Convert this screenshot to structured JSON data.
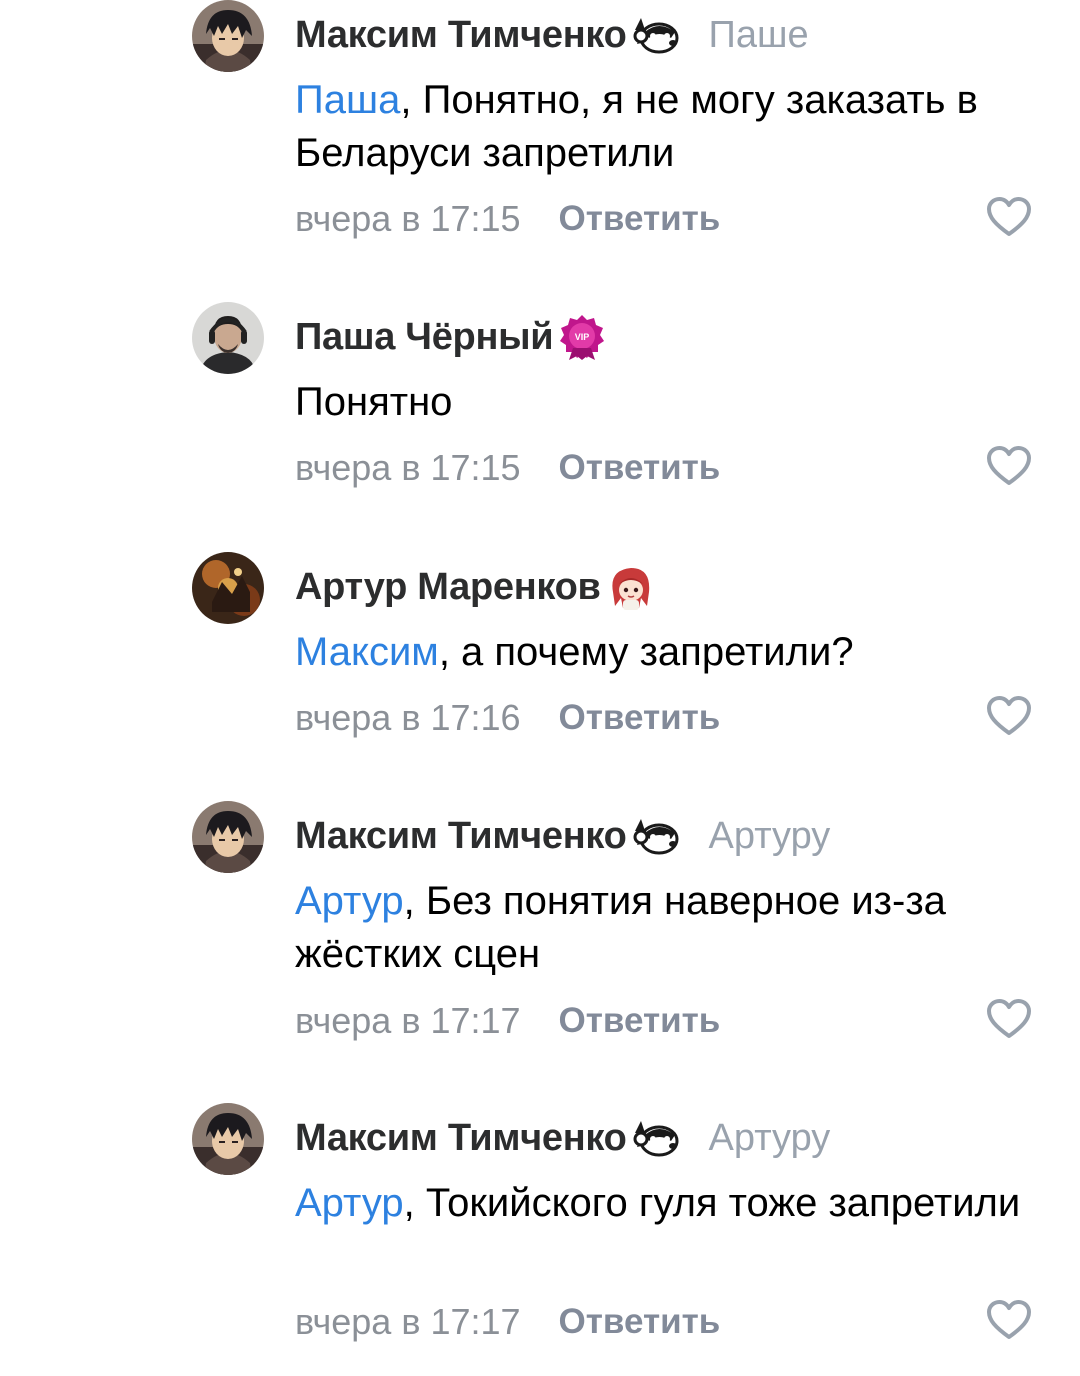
{
  "reply_label": "Ответить",
  "colors": {
    "mention": "#2d81e0",
    "author": "#2c2d2e",
    "meta": "#8b9097",
    "reply_button": "#828a99",
    "like_icon": "#99a2ad"
  },
  "comments": [
    {
      "author": "Максим Тимченко",
      "badge_icon": "raccoon-ok-sticker-icon",
      "reply_to": "Паше",
      "mention": "Паша",
      "text": ", Понятно, я не могу заказать в Беларуси запретили",
      "time": "вчера в 17:15"
    },
    {
      "author": "Паша Чёрный",
      "badge_icon": "vip-badge-icon",
      "reply_to": "",
      "mention": "",
      "text": "Понятно",
      "time": "вчера в 17:15"
    },
    {
      "author": "Артур Маренков",
      "badge_icon": "anime-girl-sticker-icon",
      "reply_to": "",
      "mention": "Максим",
      "text": ", а почему запретили?",
      "time": "вчера в 17:16"
    },
    {
      "author": "Максим Тимченко",
      "badge_icon": "raccoon-ok-sticker-icon",
      "reply_to": "Артуру",
      "mention": "Артур",
      "text": ", Без понятия наверное из-за жёстких сцен",
      "time": "вчера в 17:17"
    },
    {
      "author": "Максим Тимченко",
      "badge_icon": "raccoon-ok-sticker-icon",
      "reply_to": "Артуру",
      "mention": "Артур",
      "text": ", Токийского гуля тоже запретили",
      "time": "вчера в 17:17"
    }
  ]
}
